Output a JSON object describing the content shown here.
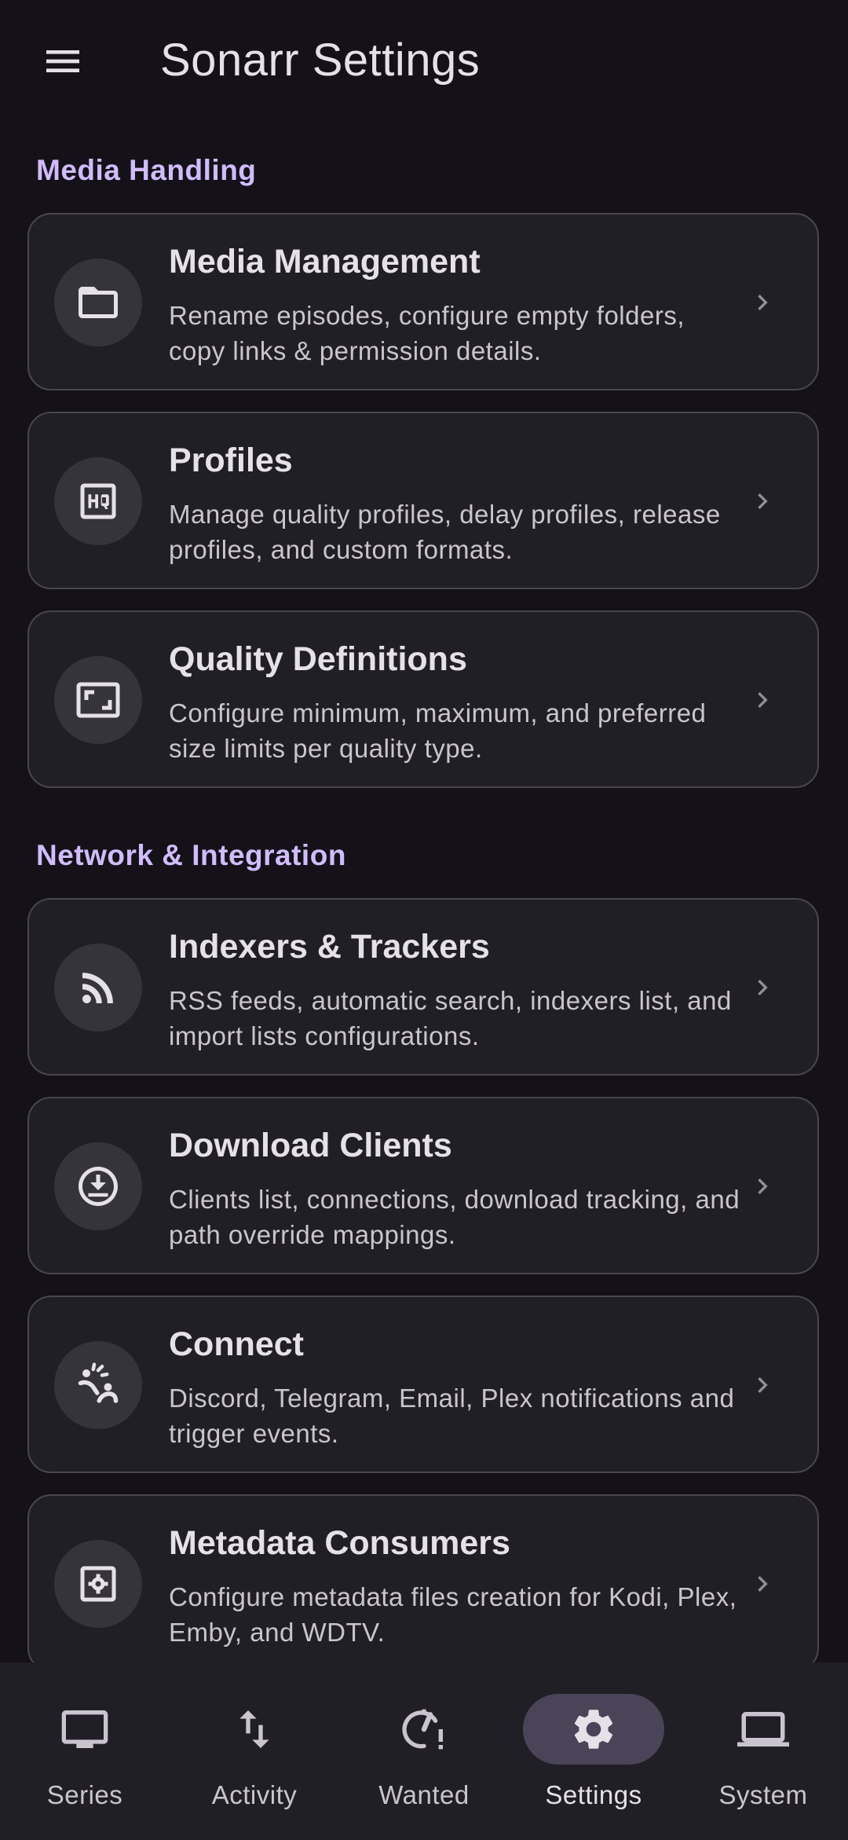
{
  "app": {
    "title": "Sonarr Settings"
  },
  "sections": [
    {
      "header": "Media Handling",
      "items": [
        {
          "title": "Media Management",
          "description": "Rename episodes, configure empty folders, copy links & permission details.",
          "icon": "folder-icon"
        },
        {
          "title": "Profiles",
          "description": "Manage quality profiles, delay profiles, release profiles, and custom formats.",
          "icon": "hq-icon"
        },
        {
          "title": "Quality Definitions",
          "description": "Configure minimum, maximum, and preferred size limits per quality type.",
          "icon": "aspect-ratio-icon"
        }
      ]
    },
    {
      "header": "Network & Integration",
      "items": [
        {
          "title": "Indexers & Trackers",
          "description": "RSS feeds, automatic search, indexers list, and import lists configurations.",
          "icon": "rss-feed-icon"
        },
        {
          "title": "Download Clients",
          "description": "Clients list, connections, download tracking, and path override mappings.",
          "icon": "download-circle-icon"
        },
        {
          "title": "Connect",
          "description": "Discord, Telegram, Email, Plex notifications and trigger events.",
          "icon": "connect-icon"
        },
        {
          "title": "Metadata Consumers",
          "description": "Configure metadata files creation for Kodi, Plex, Emby, and WDTV.",
          "icon": "metadata-settings-icon"
        }
      ]
    }
  ],
  "bottom_nav": {
    "items": [
      {
        "label": "Series",
        "icon": "tv-icon",
        "active": false
      },
      {
        "label": "Activity",
        "icon": "up-down-arrows-icon",
        "active": false
      },
      {
        "label": "Wanted",
        "icon": "wanted-icon",
        "active": false
      },
      {
        "label": "Settings",
        "icon": "gear-icon",
        "active": true
      },
      {
        "label": "System",
        "icon": "laptop-icon",
        "active": false
      }
    ]
  },
  "colors": {
    "background": "#141218",
    "surface": "#211f26",
    "accent": "#d0bcff",
    "card_border": "#49454f",
    "active_indicator": "#4a4458"
  }
}
